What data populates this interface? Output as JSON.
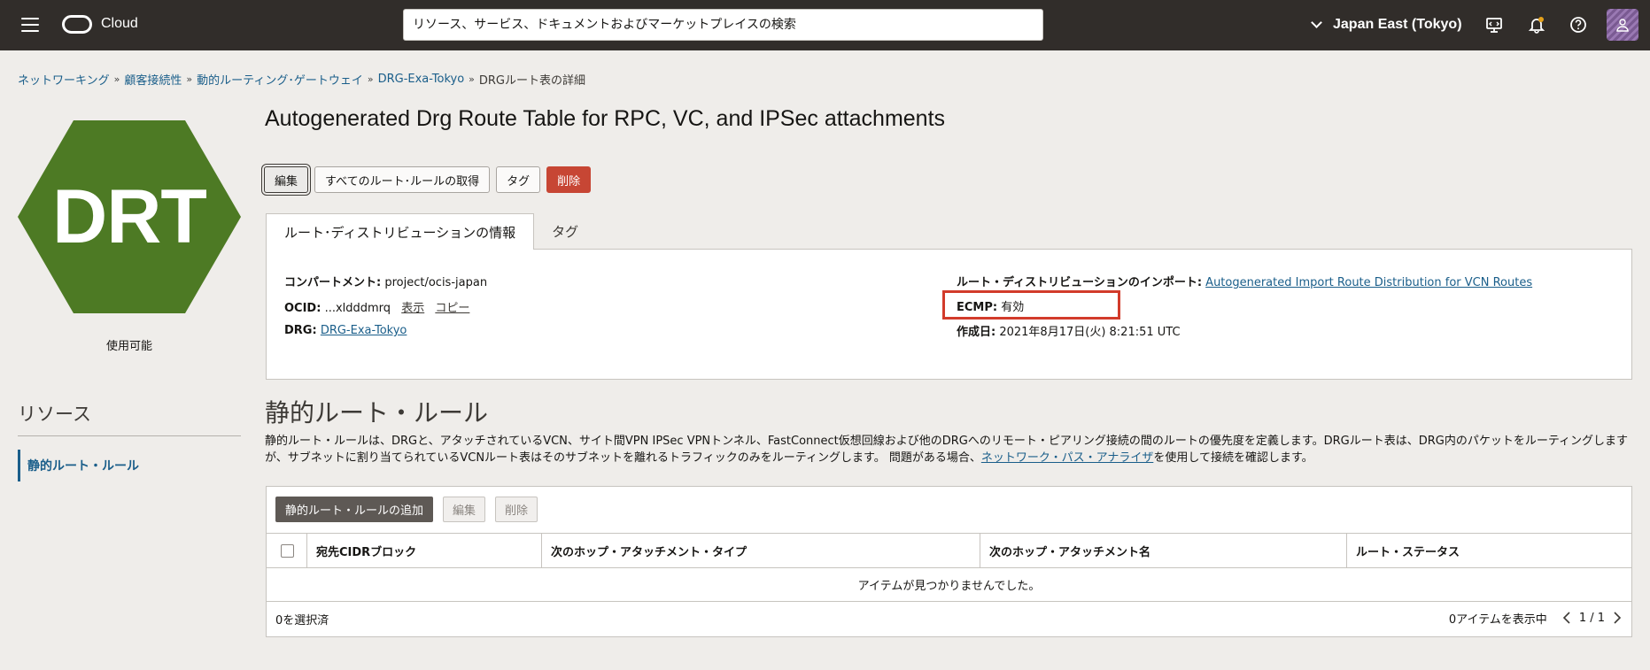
{
  "topbar": {
    "brand": "Cloud",
    "search_placeholder": "リソース、サービス、ドキュメントおよびマーケットプレイスの検索",
    "region": "Japan East (Tokyo)"
  },
  "breadcrumb": [
    "ネットワーキング",
    "顧客接続性",
    "動的ルーティング･ゲートウェイ",
    "DRG-Exa-Tokyo",
    "DRGルート表の詳細"
  ],
  "breadcrumb_sep": "»",
  "resource": {
    "abbr": "DRT",
    "status": "使用可能",
    "color": "#4d7a24"
  },
  "sidebar": {
    "title": "リソース",
    "items": [
      "静的ルート・ルール"
    ]
  },
  "page": {
    "title": "Autogenerated Drg Route Table for RPC, VC, and IPSec attachments"
  },
  "actions": {
    "edit": "編集",
    "get_all_rules": "すべてのルート･ルールの取得",
    "tags": "タグ",
    "delete": "削除"
  },
  "tabs": [
    "ルート･ディストリビューションの情報",
    "タグ"
  ],
  "info": {
    "compartment_label": "コンパートメント:",
    "compartment_value": "project/ocis-japan",
    "ocid_label": "OCID:",
    "ocid_value": "...xldddmrq",
    "ocid_show": "表示",
    "ocid_copy": "コピー",
    "drg_label": "DRG:",
    "drg_value": "DRG-Exa-Tokyo",
    "import_label": "ルート・ディストリビューションのインポート:",
    "import_value": "Autogenerated Import Route Distribution for VCN Routes",
    "ecmp_label": "ECMP:",
    "ecmp_value": "有効",
    "created_label": "作成日:",
    "created_value": "2021年8月17日(火) 8:21:51 UTC"
  },
  "static_rules": {
    "title": "静的ルート・ルール",
    "desc_1": "静的ルート・ルールは、DRGと、アタッチされているVCN、サイト間VPN IPSec VPNトンネル、FastConnect仮想回線および他のDRGへのリモート・ピアリング接続の間のルートの優先度を定義します。DRGルート表は、DRG内のパケットをルーティングしますが、サブネットに割り当てられているVCNルート表はそのサブネットを離れるトラフィックのみをルーティングします。 問題がある場合、",
    "desc_link": "ネットワーク・パス・アナライザ",
    "desc_2": "を使用して接続を確認します。",
    "add_button": "静的ルート・ルールの追加",
    "edit_button": "編集",
    "delete_button": "削除",
    "columns": [
      "宛先CIDRブロック",
      "次のホップ・アタッチメント・タイプ",
      "次のホップ・アタッチメント名",
      "ルート・ステータス"
    ],
    "empty_message": "アイテムが見つかりませんでした。",
    "selected": "0を選択済",
    "showing": "0アイテムを表示中",
    "page": "1 / 1"
  }
}
